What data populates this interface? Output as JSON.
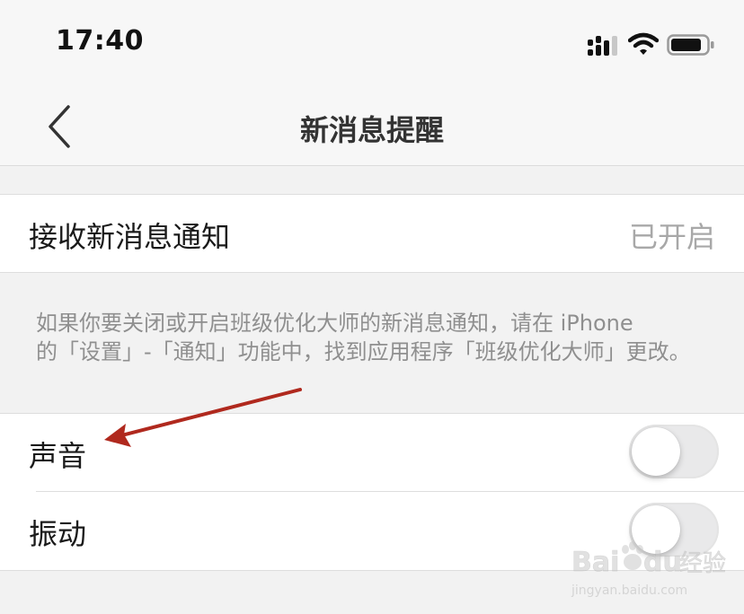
{
  "status_bar": {
    "time": "17:40",
    "icons": [
      "cellular-signal-icon",
      "wifi-icon",
      "battery-icon"
    ]
  },
  "nav": {
    "back_icon": "chevron-left-icon",
    "title": "新消息提醒"
  },
  "settings": {
    "receive_notifications": {
      "label": "接收新消息通知",
      "value": "已开启"
    },
    "hint_lines": [
      "如果你要关闭或开启班级优化大师的新消息通知，请在 iPhone",
      "的「设置」-「通知」功能中，找到应用程序「班级优化大师」更改。"
    ],
    "sound": {
      "label": "声音",
      "enabled": false
    },
    "vibration": {
      "label": "振动",
      "enabled": false
    }
  },
  "annotation": {
    "type": "red-arrow",
    "color": "#b0291e"
  },
  "watermark": {
    "brand": "Baidu经验",
    "url": "jingyan.baidu.com"
  },
  "colors": {
    "background": "#f2f2f2",
    "cell": "#ffffff",
    "secondary_text": "#a8a8a8",
    "toggle_off": "#e9e9ea"
  }
}
